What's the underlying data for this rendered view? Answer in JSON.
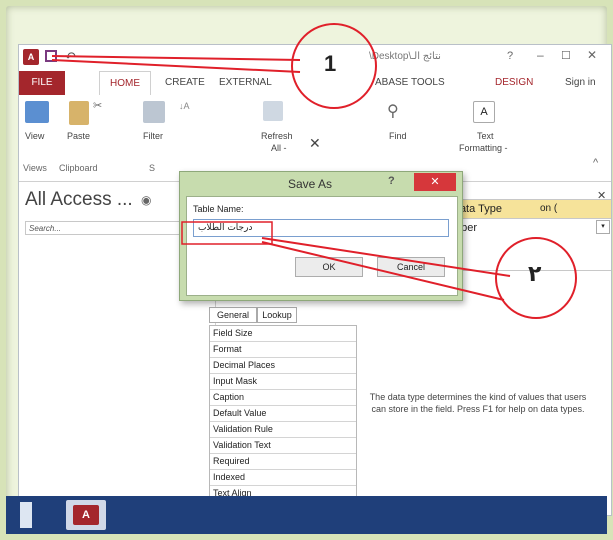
{
  "window": {
    "app_logo": "A",
    "title_fragment": "\\Desktop\\نتائج الـ",
    "help": "?",
    "minimize": "–",
    "maximize": "☐",
    "close": "✕"
  },
  "tabs": [
    "FILE",
    "HOME",
    "CREATE",
    "EXTERNAL",
    "ABASE TOOLS",
    "DESIGN",
    "Sign in"
  ],
  "ribbon": {
    "view": "View",
    "paste": "Paste",
    "filter": "Filter",
    "refresh": "Refresh",
    "refresh_all": "All -",
    "find": "Find",
    "text_formatting": "Text",
    "text_formatting2": "Formatting -",
    "group_views": "Views",
    "group_clipboard": "Clipboard",
    "group_s": "S"
  },
  "nav": {
    "title": "All Access ...",
    "search_placeholder": "Search..."
  },
  "grid": {
    "col_data_type": "Data Type",
    "col_desc": "on (",
    "row1_type": "mber"
  },
  "properties": {
    "tab_general": "General",
    "tab_lookup": "Lookup",
    "rows": [
      "Field Size",
      "Format",
      "Decimal Places",
      "Input Mask",
      "Caption",
      "Default Value",
      "Validation Rule",
      "Validation Text",
      "Required",
      "Indexed",
      "Text Align"
    ]
  },
  "help_text": "The data type determines the kind of values that users can store in the field. Press F1 for help on data types.",
  "dialog": {
    "title": "Save As",
    "help": "?",
    "close": "✕",
    "label": "Table Name:",
    "value": "درجات الطلاب",
    "ok": "OK",
    "cancel": "Cancel"
  },
  "annotations": {
    "callout1": "1",
    "callout2": "٢",
    "color": "#e0202a"
  },
  "taskbar": {
    "access_icon": "A"
  }
}
